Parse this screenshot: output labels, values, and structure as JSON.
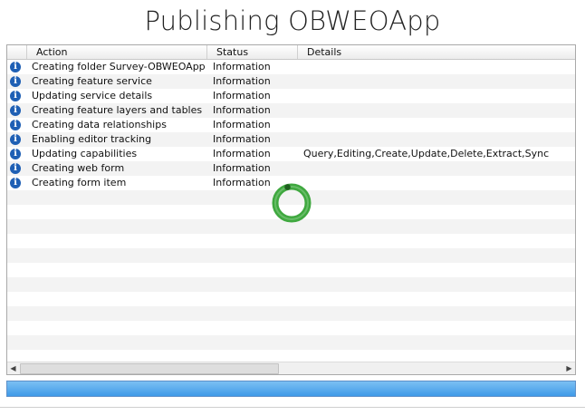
{
  "title": "Publishing OBWEOApp",
  "table": {
    "headers": {
      "action": "Action",
      "status": "Status",
      "details": "Details"
    },
    "rows": [
      {
        "icon": "info-icon",
        "action": "Creating folder Survey-OBWEOApp",
        "status": "Information",
        "details": ""
      },
      {
        "icon": "info-icon",
        "action": "Creating feature service",
        "status": "Information",
        "details": ""
      },
      {
        "icon": "info-icon",
        "action": "Updating service details",
        "status": "Information",
        "details": ""
      },
      {
        "icon": "info-icon",
        "action": "Creating feature layers and tables",
        "status": "Information",
        "details": ""
      },
      {
        "icon": "info-icon",
        "action": "Creating data relationships",
        "status": "Information",
        "details": ""
      },
      {
        "icon": "info-icon",
        "action": "Enabling editor tracking",
        "status": "Information",
        "details": ""
      },
      {
        "icon": "info-icon",
        "action": "Updating capabilities",
        "status": "Information",
        "details": "Query,Editing,Create,Update,Delete,Extract,Sync"
      },
      {
        "icon": "info-icon",
        "action": "Creating web form",
        "status": "Information",
        "details": ""
      },
      {
        "icon": "info-icon",
        "action": "Creating form item",
        "status": "Information",
        "details": ""
      }
    ],
    "info_glyph": "i"
  },
  "scrollbar": {
    "left_arrow": "◀",
    "right_arrow": "▶"
  },
  "progress": {
    "value": 1.0,
    "color": "#3f9ae8"
  },
  "spinner": {
    "color": "#3fa83f",
    "state": "busy"
  }
}
